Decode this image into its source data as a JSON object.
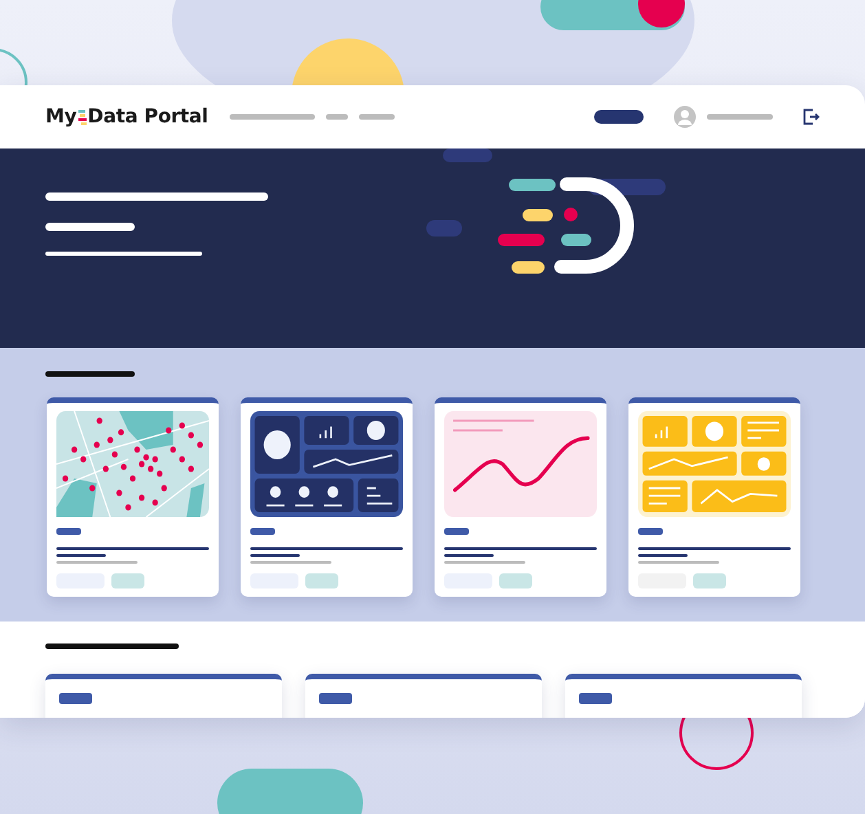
{
  "brand": {
    "prefix": "My",
    "name": "Data Portal"
  },
  "cards": [
    {
      "kind": "map"
    },
    {
      "kind": "dashboard-dark"
    },
    {
      "kind": "line-chart"
    },
    {
      "kind": "dashboard-yellow"
    }
  ]
}
